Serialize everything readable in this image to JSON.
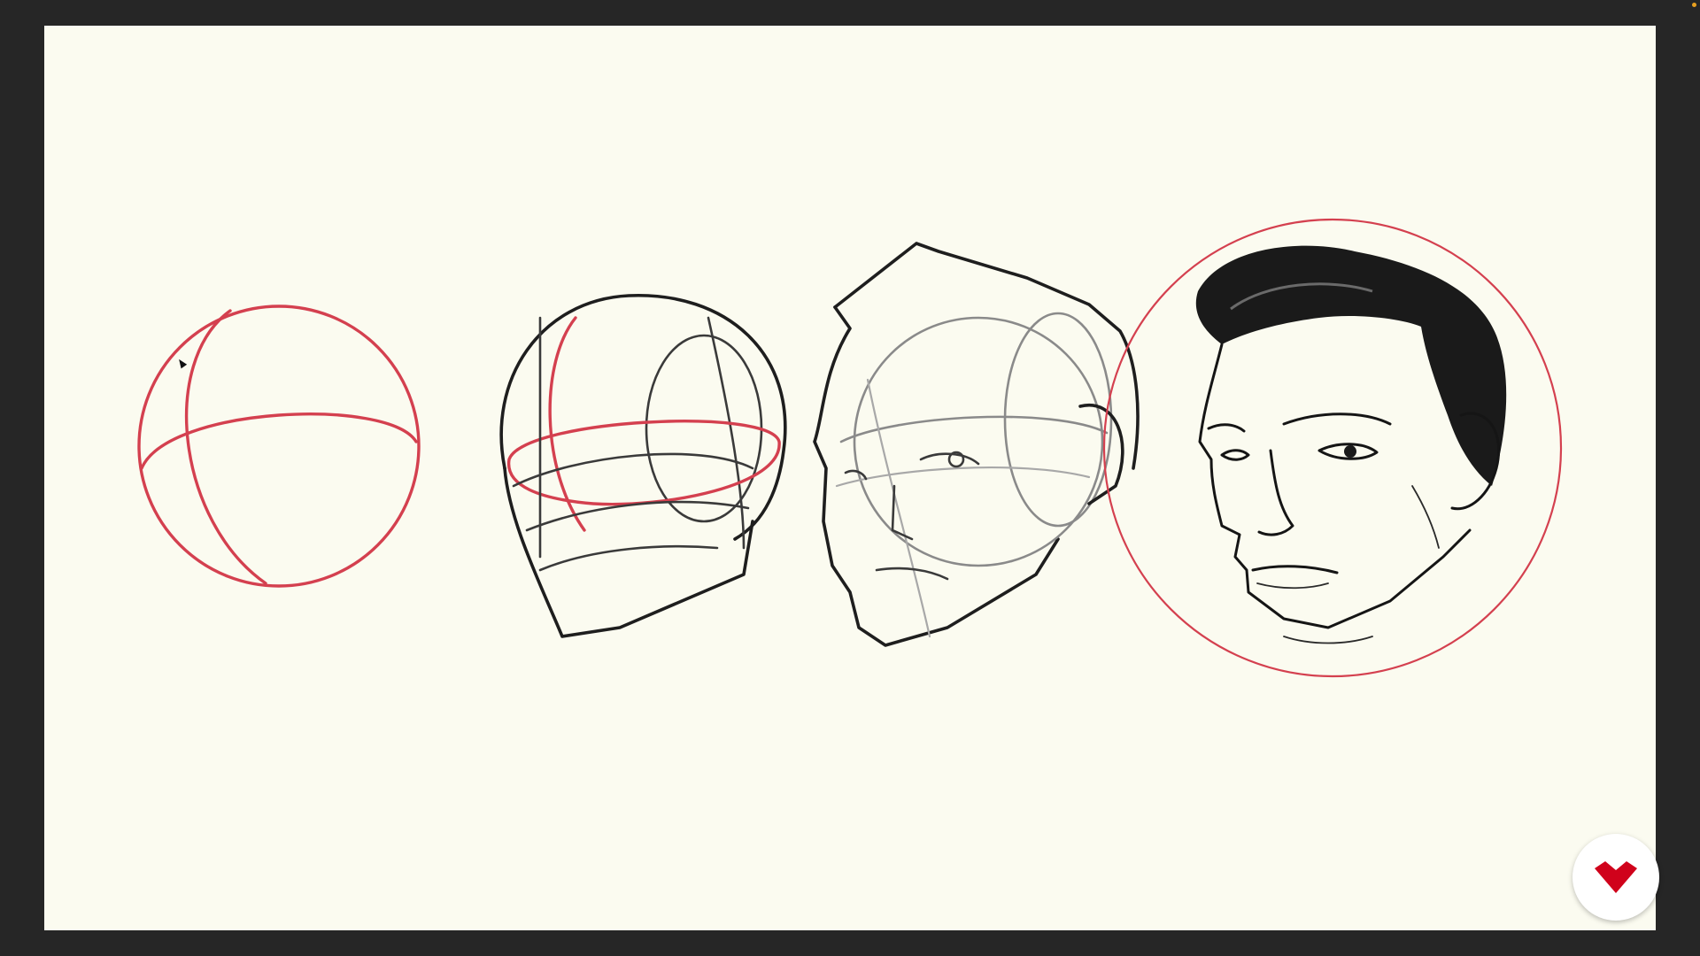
{
  "app": {
    "background_color": "#262626",
    "canvas_color": "#fbfbf0",
    "accent_color": "#d4404f",
    "ink_color": "#1e1e1e"
  },
  "canvas": {
    "stages": [
      {
        "name": "sphere-construction",
        "stroke_color": "#d4404f"
      },
      {
        "name": "head-block-construction",
        "stroke_color": "#1e1e1e"
      },
      {
        "name": "face-planes-construction",
        "stroke_color": "#8a8a8a"
      },
      {
        "name": "finished-portrait",
        "stroke_color": "#151515"
      }
    ],
    "cursor_icon": "arrow-pointer-icon"
  },
  "brand_badge": {
    "icon": "brand-logo-icon",
    "color": "#d0021b"
  }
}
